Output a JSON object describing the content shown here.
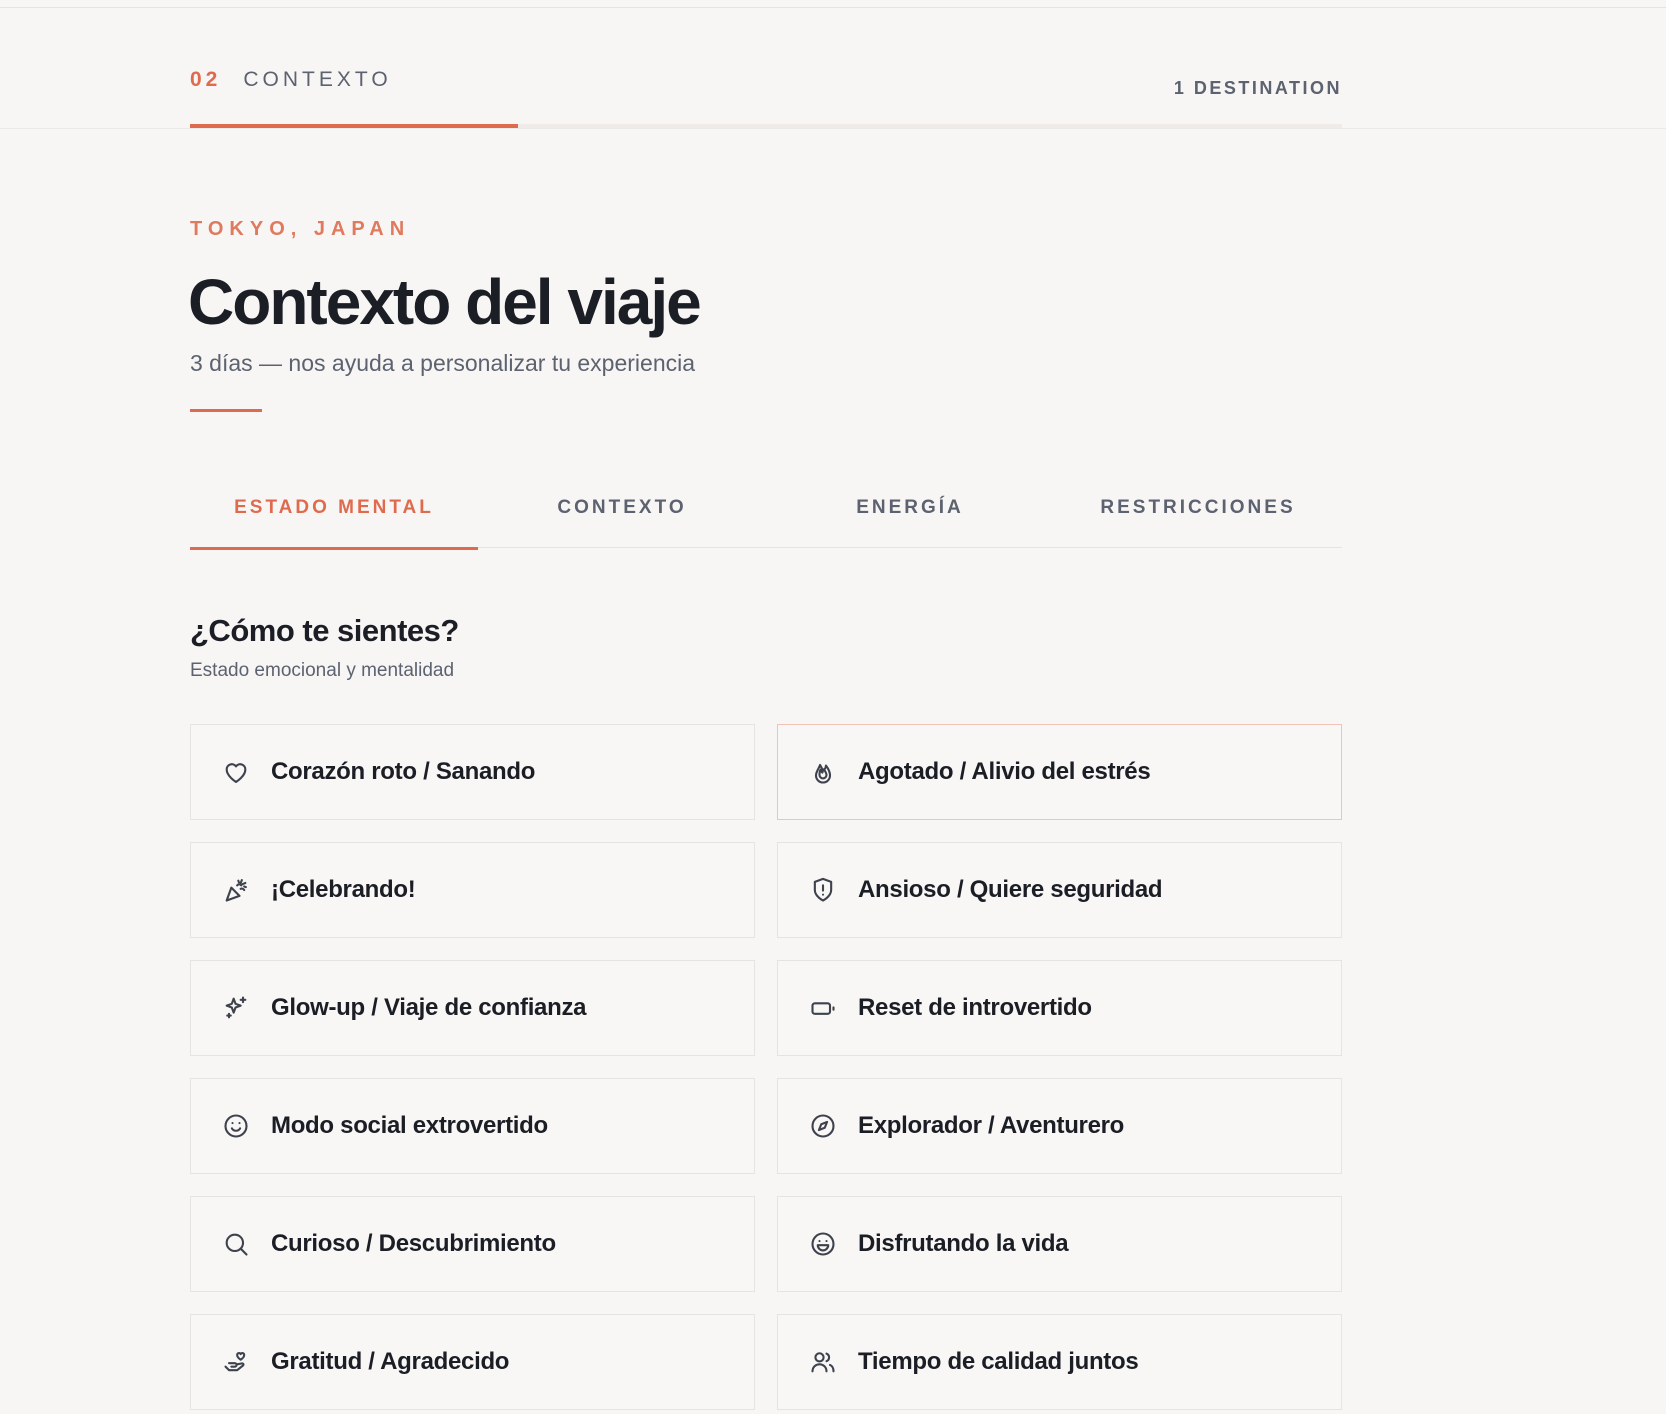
{
  "header": {
    "step_number": "02",
    "step_name": "CONTEXTO",
    "destination_count": "1 DESTINATION",
    "progress_fraction": 0.285
  },
  "trip": {
    "city": "TOKYO, JAPAN",
    "title": "Contexto del viaje",
    "subtitle": "3 días — nos ayuda a personalizar tu experiencia"
  },
  "tabs": [
    {
      "label": "ESTADO MENTAL",
      "active": true
    },
    {
      "label": "CONTEXTO",
      "active": false
    },
    {
      "label": "ENERGÍA",
      "active": false
    },
    {
      "label": "RESTRICCIONES",
      "active": false
    }
  ],
  "question": {
    "title": "¿Cómo te sientes?",
    "subtitle": "Estado emocional y mentalidad"
  },
  "options": [
    {
      "label": "Corazón roto / Sanando",
      "icon": "heart-icon",
      "selected": false
    },
    {
      "label": "Agotado / Alivio del estrés",
      "icon": "flame-icon",
      "selected": true
    },
    {
      "label": "¡Celebrando!",
      "icon": "party-popper-icon",
      "selected": false
    },
    {
      "label": "Ansioso / Quiere seguridad",
      "icon": "shield-alert-icon",
      "selected": false
    },
    {
      "label": "Glow-up / Viaje de confianza",
      "icon": "sparkles-icon",
      "selected": false
    },
    {
      "label": "Reset de introvertido",
      "icon": "battery-low-icon",
      "selected": false
    },
    {
      "label": "Modo social extrovertido",
      "icon": "smile-icon",
      "selected": false
    },
    {
      "label": "Explorador / Aventurero",
      "icon": "compass-icon",
      "selected": false
    },
    {
      "label": "Curioso / Descubrimiento",
      "icon": "search-icon",
      "selected": false
    },
    {
      "label": "Disfrutando la vida",
      "icon": "laugh-icon",
      "selected": false
    },
    {
      "label": "Gratitud / Agradecido",
      "icon": "hand-heart-icon",
      "selected": false
    },
    {
      "label": "Tiempo de calidad juntos",
      "icon": "users-icon",
      "selected": false
    }
  ],
  "colors": {
    "accent": "#df6b4e",
    "background": "#f8f6f4",
    "text": "#1c1e26",
    "muted": "#5c6270"
  }
}
